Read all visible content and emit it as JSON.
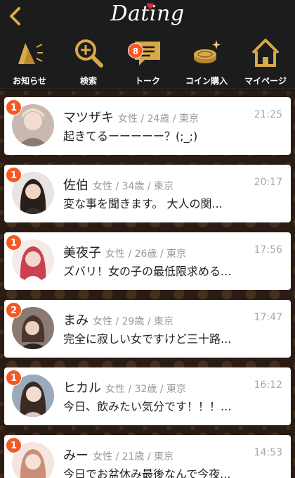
{
  "header": {
    "title": "Dating"
  },
  "nav": [
    {
      "label": "お知らせ",
      "icon": "announcement-icon"
    },
    {
      "label": "検索",
      "icon": "search-icon"
    },
    {
      "label": "トーク",
      "icon": "chat-icon",
      "badge": "8"
    },
    {
      "label": "コイン購入",
      "icon": "coin-icon"
    },
    {
      "label": "マイページ",
      "icon": "home-icon"
    }
  ],
  "messages": [
    {
      "name": "マツザキ",
      "meta": "女性 / 24歳 / 東京",
      "text": "起きてるーーーーー？(;_;)",
      "time": "21:25",
      "unread": "1",
      "avatar_color": "#c9b8b0"
    },
    {
      "name": "佐伯",
      "meta": "女性 / 34歳 / 東京",
      "text": "変な事を聞きます。 大人の関...",
      "time": "20:17",
      "unread": "1",
      "avatar_color": "#3a2e2a"
    },
    {
      "name": "美夜子",
      "meta": "女性 / 26歳 / 東京",
      "text": "ズバリ！女の子の最低限求める...",
      "time": "17:56",
      "unread": "1",
      "avatar_color": "#c9424f"
    },
    {
      "name": "まみ",
      "meta": "女性 / 29歳 / 東京",
      "text": "完全に寂しい女ですけど三十路...",
      "time": "17:47",
      "unread": "2",
      "avatar_color": "#5a4a40"
    },
    {
      "name": "ヒカル",
      "meta": "女性 / 32歳 / 東京",
      "text": "今日、飲みたい気分です！！！...",
      "time": "16:12",
      "unread": "1",
      "avatar_color": "#7a8aa0"
    },
    {
      "name": "みー",
      "meta": "女性 / 21歳 / 東京",
      "text": "今日でお盆休み最後なんで今夜...",
      "time": "14:53",
      "unread": "1",
      "avatar_color": "#e8b8b0"
    }
  ],
  "colors": {
    "accent": "#f25a24",
    "gold": "#d8a84a",
    "header_bg": "#1c1c1c"
  }
}
